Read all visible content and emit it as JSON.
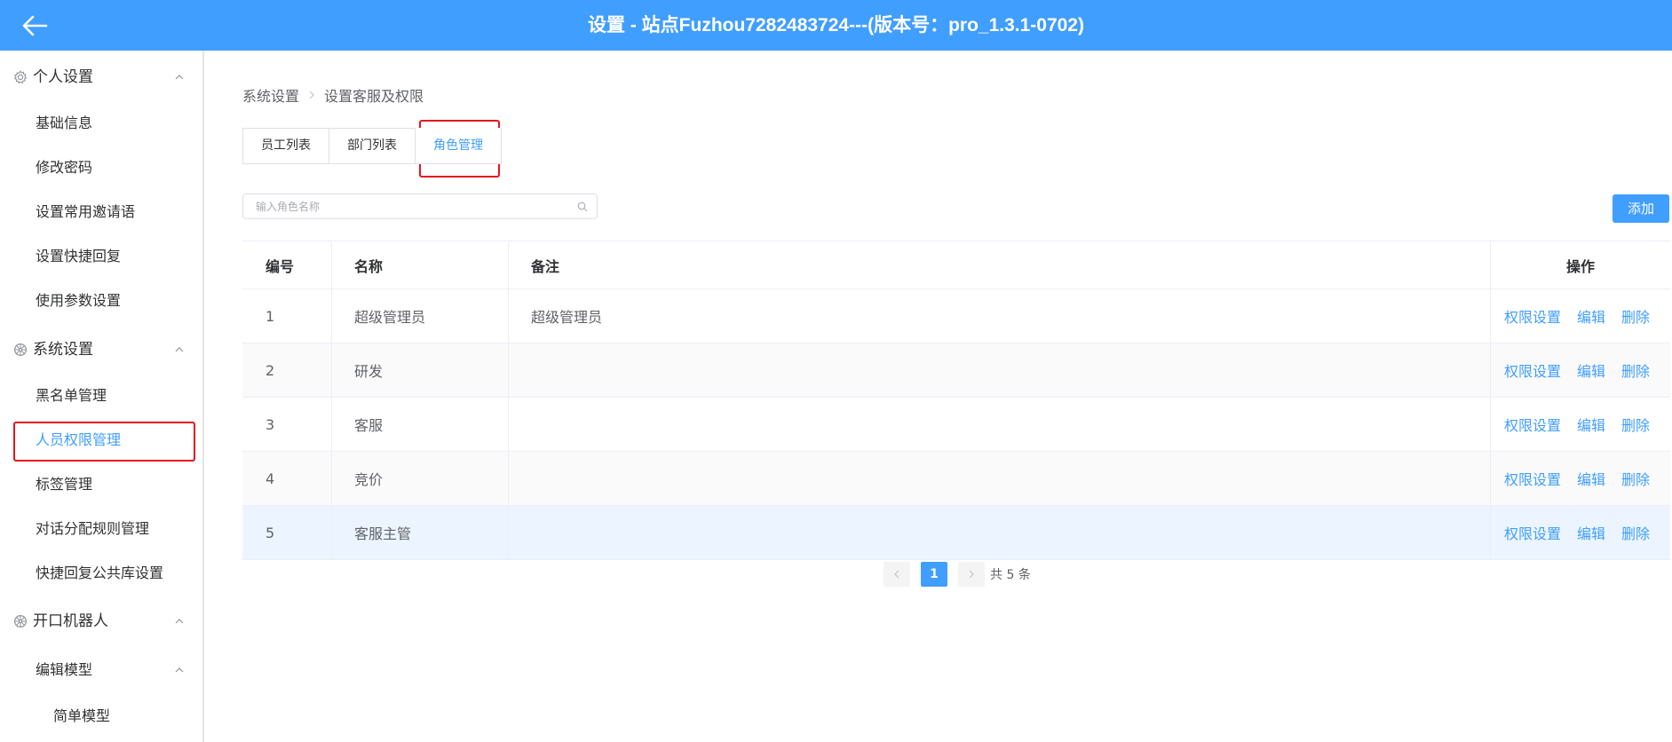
{
  "header": {
    "title": "设置 - 站点Fuzhou7282483724---(版本号：pro_1.3.1-0702)"
  },
  "sidebar": {
    "groups": [
      {
        "label": "个人设置",
        "icon": "gear-icon",
        "items": [
          {
            "label": "基础信息"
          },
          {
            "label": "修改密码"
          },
          {
            "label": "设置常用邀请语"
          },
          {
            "label": "设置快捷回复"
          },
          {
            "label": "使用参数设置"
          }
        ]
      },
      {
        "label": "系统设置",
        "icon": "wheel-icon",
        "items": [
          {
            "label": "黑名单管理"
          },
          {
            "label": "人员权限管理",
            "active": true
          },
          {
            "label": "标签管理"
          },
          {
            "label": "对话分配规则管理"
          },
          {
            "label": "快捷回复公共库设置"
          }
        ]
      },
      {
        "label": "开口机器人",
        "icon": "wheel-icon",
        "items": [
          {
            "label": "编辑模型",
            "expandable": true
          },
          {
            "label": "简单模型"
          }
        ]
      }
    ]
  },
  "breadcrumb": [
    "系统设置",
    "设置客服及权限"
  ],
  "tabs": [
    {
      "label": "员工列表"
    },
    {
      "label": "部门列表"
    },
    {
      "label": "角色管理",
      "active": true
    }
  ],
  "search": {
    "placeholder": "输入角色名称",
    "value": ""
  },
  "add_button": "添加",
  "table": {
    "columns": [
      "编号",
      "名称",
      "备注",
      "操作"
    ],
    "rows": [
      {
        "no": "1",
        "name": "超级管理员",
        "note": "超级管理员"
      },
      {
        "no": "2",
        "name": "研发",
        "note": ""
      },
      {
        "no": "3",
        "name": "客服",
        "note": ""
      },
      {
        "no": "4",
        "name": "竞价",
        "note": ""
      },
      {
        "no": "5",
        "name": "客服主管",
        "note": ""
      }
    ],
    "actions": [
      "权限设置",
      "编辑",
      "删除"
    ]
  },
  "pagination": {
    "current": "1",
    "total_text": "共 5 条"
  },
  "colors": {
    "primary": "#409eff",
    "highlight": "#e5151e"
  }
}
